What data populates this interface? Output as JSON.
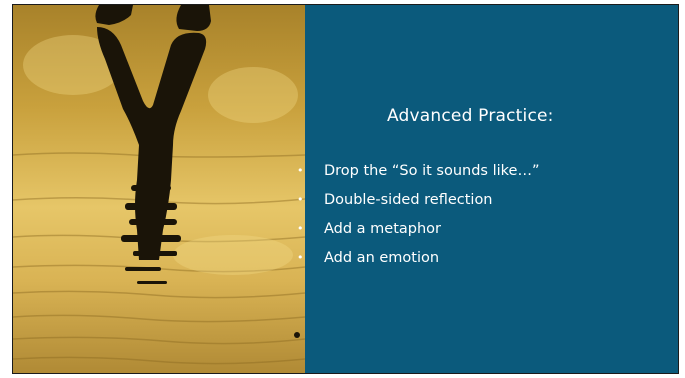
{
  "slide": {
    "title": "Advanced Practice:",
    "bullets": [
      "Drop the “So it sounds like…”",
      "Double-sided reflection",
      "Add a metaphor",
      "Add an emotion"
    ],
    "bullet_glyph": "•",
    "colors": {
      "panel": "#0b5a7c",
      "text": "#ffffff",
      "photo_light": "#e6c668",
      "photo_dark": "#a8822a",
      "silhouette": "#1a1408"
    },
    "image": "silhouette-reflection-in-water"
  }
}
